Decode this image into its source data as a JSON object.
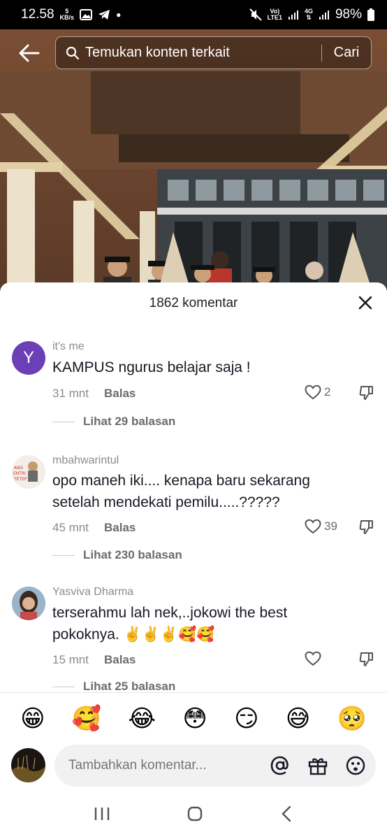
{
  "status_bar": {
    "time": "12.58",
    "speed_value": "5",
    "speed_unit": "KB/s",
    "network": "LTE1",
    "network_4g": "4G",
    "battery": "98%"
  },
  "search": {
    "placeholder": "Temukan konten terkait",
    "button_label": "Cari"
  },
  "comments_panel": {
    "title": "1862 komentar"
  },
  "comments": [
    {
      "username": "it's me",
      "avatar_letter": "Y",
      "avatar_color": "#6b3fb5",
      "text": "KAMPUS ngurus belajar saja !",
      "time": "31 mnt",
      "reply_label": "Balas",
      "likes": "2",
      "view_replies": "Lihat 29 balasan"
    },
    {
      "username": "mbahwarintul",
      "text": "opo maneh iki.... kenapa baru sekarang setelah mendekati pemilu.....?????",
      "time": "45 mnt",
      "reply_label": "Balas",
      "likes": "39",
      "view_replies": "Lihat 230 balasan"
    },
    {
      "username": "Yasviva Dharma",
      "text": "terserahmu lah nek,..jokowi the best pokoknya. ✌️✌️✌️🥰🥰",
      "time": "15 mnt",
      "reply_label": "Balas",
      "likes": "",
      "view_replies": "Lihat 25 balasan"
    }
  ],
  "emojis": [
    "😁",
    "🥰",
    "😂",
    "😳",
    "😏",
    "😅",
    "🥺"
  ],
  "input": {
    "placeholder": "Tambahkan komentar..."
  },
  "colors": {
    "accent_text": "#161823",
    "muted_text": "#8a8b91",
    "input_bg": "#f1f1f2"
  }
}
